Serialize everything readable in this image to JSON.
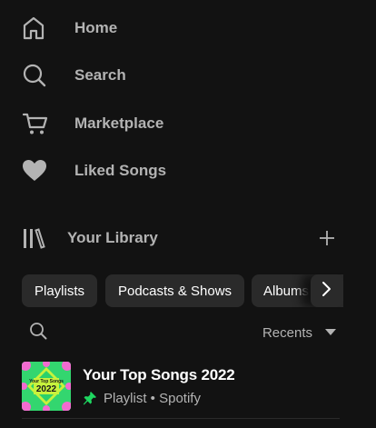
{
  "nav": {
    "items": [
      {
        "label": "Home",
        "icon": "home-icon"
      },
      {
        "label": "Search",
        "icon": "search-icon"
      },
      {
        "label": "Marketplace",
        "icon": "cart-icon"
      },
      {
        "label": "Liked Songs",
        "icon": "heart-icon"
      }
    ]
  },
  "library": {
    "title": "Your Library",
    "chips": [
      "Playlists",
      "Podcasts & Shows",
      "Albums"
    ],
    "sort_label": "Recents",
    "playlist": {
      "title": "Your Top Songs 2022",
      "meta": "Playlist • Spotify",
      "cover_text_top": "Your Top Songs",
      "cover_text_year": "2022"
    }
  },
  "colors": {
    "background": "#121212",
    "text_muted": "#b3b3b3",
    "chip_bg": "#2a2a2a",
    "accent_green": "#1ed760"
  }
}
